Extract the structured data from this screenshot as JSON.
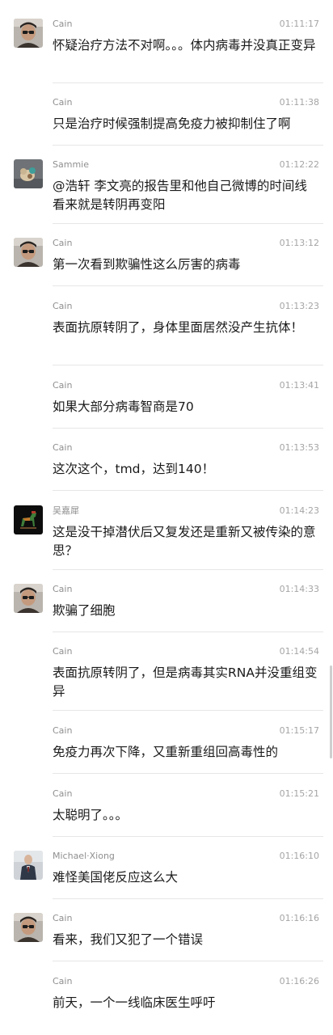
{
  "messages": [
    {
      "sender": "Cain",
      "time": "01:11:17",
      "avatar": "cain",
      "text": "怀疑治疗方法不对啊。。。体内病毒并没真正变异"
    },
    {
      "sender": "Cain",
      "time": "01:11:38",
      "avatar": "",
      "text": "只是治疗时候强制提高免疫力被抑制住了啊"
    },
    {
      "sender": "Sammie",
      "time": "01:12:22",
      "avatar": "sammie",
      "text": "@浩轩 李文亮的报告里和他自己微博的时间线看来就是转阴再变阳"
    },
    {
      "sender": "Cain",
      "time": "01:13:12",
      "avatar": "cain",
      "text": "第一次看到欺骗性这么厉害的病毒"
    },
    {
      "sender": "Cain",
      "time": "01:13:23",
      "avatar": "",
      "text": "表面抗原转阴了，身体里面居然没产生抗体！"
    },
    {
      "sender": "Cain",
      "time": "01:13:41",
      "avatar": "",
      "text": "如果大部分病毒智商是70"
    },
    {
      "sender": "Cain",
      "time": "01:13:53",
      "avatar": "",
      "text": "这次这个，tmd，达到140！"
    },
    {
      "sender": "吴嘉犀",
      "time": "01:14:23",
      "avatar": "horse",
      "text": "这是没干掉潜伏后又复发还是重新又被传染的意思？"
    },
    {
      "sender": "Cain",
      "time": "01:14:33",
      "avatar": "cain",
      "text": "欺骗了细胞"
    },
    {
      "sender": "Cain",
      "time": "01:14:54",
      "avatar": "",
      "text": "表面抗原转阴了，但是病毒其实RNA并没重组变异"
    },
    {
      "sender": "Cain",
      "time": "01:15:17",
      "avatar": "",
      "text": "免疫力再次下降，又重新重组回高毒性的"
    },
    {
      "sender": "Cain",
      "time": "01:15:21",
      "avatar": "",
      "text": "太聪明了。。。"
    },
    {
      "sender": "Michael·Xiong",
      "time": "01:16:10",
      "avatar": "michael",
      "text": "难怪美国佬反应这么大"
    },
    {
      "sender": "Cain",
      "time": "01:16:16",
      "avatar": "cain",
      "text": "看来，我们又犯了一个错误"
    },
    {
      "sender": "Cain",
      "time": "01:16:26",
      "avatar": "",
      "text": "前天，一个一线临床医生呼吁"
    }
  ]
}
